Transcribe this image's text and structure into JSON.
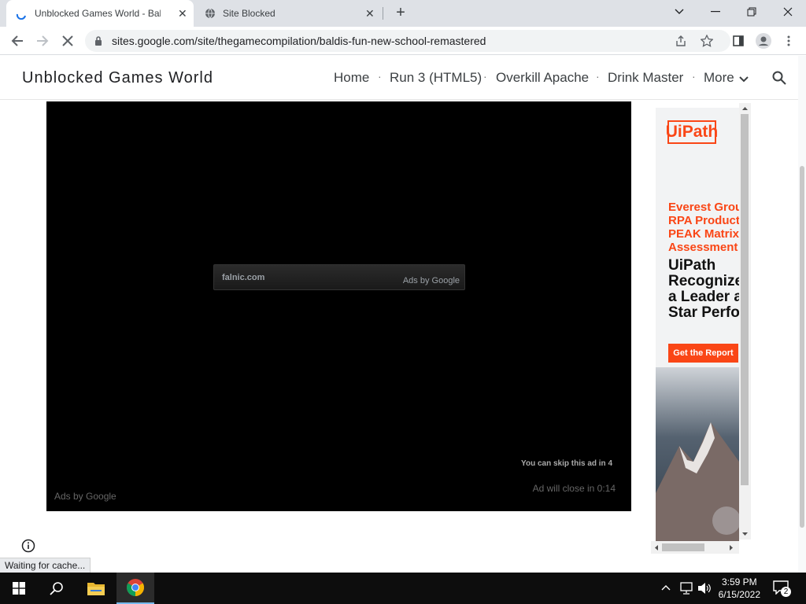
{
  "browser": {
    "tabs": [
      {
        "title": "Unblocked Games World - Baldi's",
        "active": true
      },
      {
        "title": "Site Blocked",
        "active": false
      }
    ],
    "url": "sites.google.com/site/thegamecompilation/baldis-fun-new-school-remastered",
    "status": "Waiting for cache..."
  },
  "site": {
    "title": "Unblocked Games World",
    "nav": [
      "Home",
      "Run 3 (HTML5)",
      "Overkill Apache",
      "Drink Master",
      "More"
    ]
  },
  "player_ad": {
    "domain": "falnic.com",
    "ads_label": "Ads by Google",
    "skip_text": "You can skip this ad in 4",
    "close_text": "Ad will close in 0:14",
    "footer_label": "Ads by Google"
  },
  "banner_ad": {
    "brand": "UiPath",
    "headline_lines": [
      "Everest Grou",
      "RPA Product",
      "PEAK Matrix",
      "Assessment"
    ],
    "subhead_lines": [
      "UiPath",
      "Recognize",
      "a Leader ar",
      "Star Perfor"
    ],
    "cta": "Get the Report",
    "accent_color": "#fa4616"
  },
  "taskbar": {
    "time": "3:59 PM",
    "date": "6/15/2022",
    "notification_count": "2"
  }
}
